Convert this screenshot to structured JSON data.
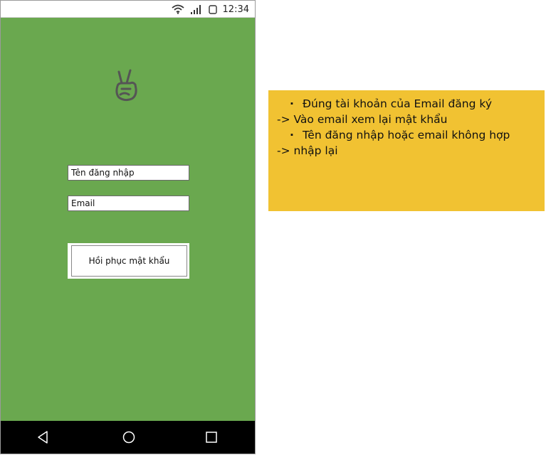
{
  "status_bar": {
    "time": "12:34",
    "icons": [
      "wifi-icon",
      "signal-icon",
      "battery-icon"
    ]
  },
  "form": {
    "username_placeholder": "Tên đăng nhập",
    "email_placeholder": "Email",
    "submit_label": "Hồi phục mật khẩu"
  },
  "nav": {
    "icons": [
      "back-icon",
      "home-icon",
      "recent-apps-icon"
    ]
  },
  "note": {
    "lines": [
      "Đúng tài khoản của Email đăng ký",
      "-> Vào email xem lại mật khẩu",
      "Tên đăng nhập hoặc email không hợp",
      "-> nhập lại"
    ]
  },
  "colors": {
    "phone_background": "#6aa84f",
    "note_background": "#f1c232",
    "navbar_background": "#000000"
  }
}
